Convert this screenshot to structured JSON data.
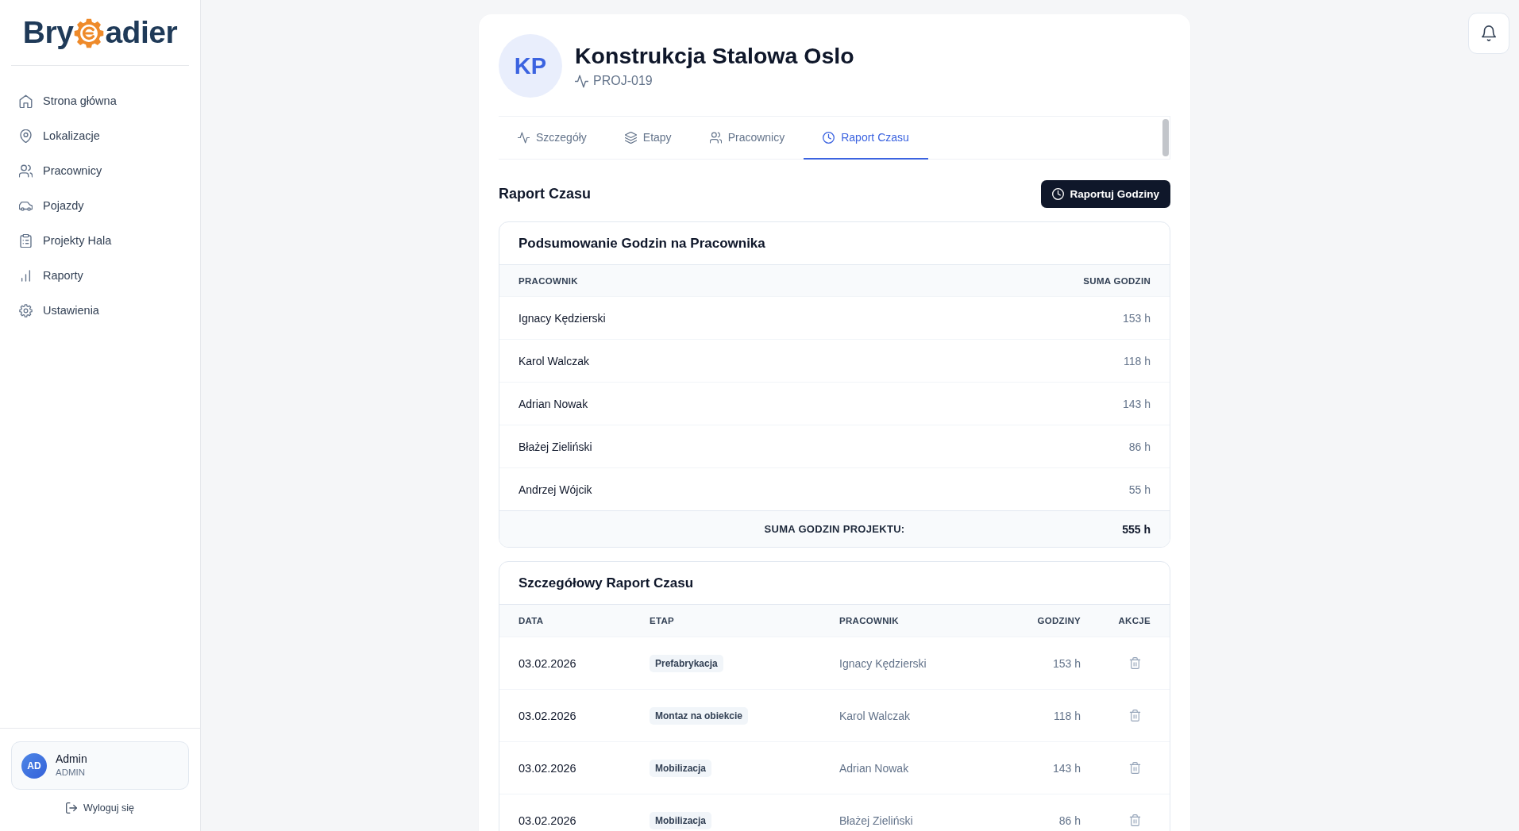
{
  "sidebar": {
    "logo": {
      "text_start": "Bry",
      "text_end": "adier"
    },
    "nav": [
      {
        "label": "Strona główna",
        "selected": false
      },
      {
        "label": "Lokalizacje",
        "selected": false
      },
      {
        "label": "Pracownicy",
        "selected": false
      },
      {
        "label": "Pojazdy",
        "selected": false
      },
      {
        "label": "Projekty Hala",
        "selected": false
      },
      {
        "label": "Raporty",
        "selected": false
      },
      {
        "label": "Ustawienia",
        "selected": false
      }
    ],
    "user": {
      "initials": "AD",
      "name": "Admin",
      "role": "ADMIN"
    },
    "logout": "Wyloguj się"
  },
  "project": {
    "initials": "KP",
    "title": "Konstrukcja Stalowa Oslo",
    "code": "PROJ-019"
  },
  "tabs": [
    {
      "label": "Szczegóły",
      "selected": false
    },
    {
      "label": "Etapy",
      "selected": false
    },
    {
      "label": "Pracownicy",
      "selected": false
    },
    {
      "label": "Raport Czasu",
      "selected": true
    }
  ],
  "section": {
    "title": "Raport Czasu",
    "button": "Raportuj Godziny"
  },
  "summary": {
    "title": "Podsumowanie Godzin na Pracownika",
    "columns": [
      "PRACOWNIK",
      "SUMA GODZIN"
    ],
    "rows": [
      {
        "worker": "Ignacy Kędzierski",
        "hours": "153 h"
      },
      {
        "worker": "Karol Walczak",
        "hours": "118 h"
      },
      {
        "worker": "Adrian Nowak",
        "hours": "143 h"
      },
      {
        "worker": "Błażej Zieliński",
        "hours": "86 h"
      },
      {
        "worker": "Andrzej Wójcik",
        "hours": "55 h"
      }
    ],
    "total_label": "SUMA GODZIN PROJEKTU:",
    "total": "555 h"
  },
  "details": {
    "title": "Szczegółowy Raport Czasu",
    "columns": [
      "DATA",
      "ETAP",
      "PRACOWNIK",
      "GODZINY",
      "AKCJE"
    ],
    "rows": [
      {
        "date": "03.02.2026",
        "stage": "Prefabrykacja",
        "worker": "Ignacy Kędzierski",
        "hours": "153 h"
      },
      {
        "date": "03.02.2026",
        "stage": "Montaz na obiekcie",
        "worker": "Karol Walczak",
        "hours": "118 h"
      },
      {
        "date": "03.02.2026",
        "stage": "Mobilizacja",
        "worker": "Adrian Nowak",
        "hours": "143 h"
      },
      {
        "date": "03.02.2026",
        "stage": "Mobilizacja",
        "worker": "Błażej Zieliński",
        "hours": "86 h"
      }
    ]
  }
}
